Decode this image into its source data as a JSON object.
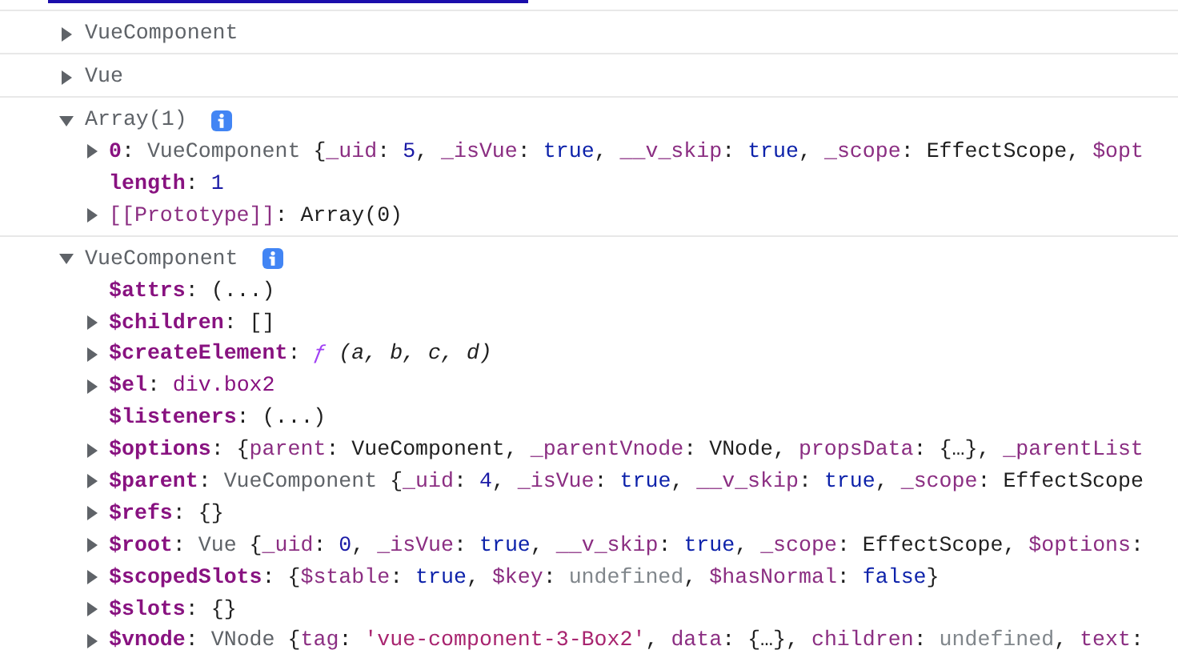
{
  "console_entries": [
    {
      "label": "VueComponent",
      "expanded": false,
      "info_badge": false
    },
    {
      "label": "Vue",
      "expanded": false,
      "info_badge": false
    },
    {
      "label": "Array(1)",
      "expanded": true,
      "info_badge": true,
      "properties": [
        {
          "key": "0",
          "expandable": true,
          "internal": false,
          "value": [
            {
              "kind": "punct",
              "text": ": "
            },
            {
              "kind": "class",
              "text": "VueComponent "
            },
            {
              "kind": "punct",
              "text": "{"
            },
            {
              "kind": "prop",
              "text": "_uid"
            },
            {
              "kind": "punct",
              "text": ": "
            },
            {
              "kind": "num",
              "text": "5"
            },
            {
              "kind": "punct",
              "text": ", "
            },
            {
              "kind": "prop",
              "text": "_isVue"
            },
            {
              "kind": "punct",
              "text": ": "
            },
            {
              "kind": "bool",
              "text": "true"
            },
            {
              "kind": "punct",
              "text": ", "
            },
            {
              "kind": "prop",
              "text": "__v_skip"
            },
            {
              "kind": "punct",
              "text": ": "
            },
            {
              "kind": "bool",
              "text": "true"
            },
            {
              "kind": "punct",
              "text": ", "
            },
            {
              "kind": "prop",
              "text": "_scope"
            },
            {
              "kind": "punct",
              "text": ": EffectScope, "
            },
            {
              "kind": "prop",
              "text": "$opt"
            }
          ]
        },
        {
          "key": "length",
          "expandable": false,
          "internal": false,
          "value": [
            {
              "kind": "punct",
              "text": ": "
            },
            {
              "kind": "num",
              "text": "1"
            }
          ]
        },
        {
          "key": "[[Prototype]]",
          "expandable": true,
          "internal": true,
          "value": [
            {
              "kind": "punct",
              "text": ": Array(0)"
            }
          ]
        }
      ]
    },
    {
      "label": "VueComponent",
      "expanded": true,
      "info_badge": true,
      "properties": [
        {
          "key": "$attrs",
          "expandable": false,
          "internal": false,
          "value": [
            {
              "kind": "punct",
              "text": ": (...)"
            }
          ]
        },
        {
          "key": "$children",
          "expandable": true,
          "internal": false,
          "value": [
            {
              "kind": "punct",
              "text": ": []"
            }
          ]
        },
        {
          "key": "$createElement",
          "expandable": true,
          "internal": false,
          "value": [
            {
              "kind": "punct",
              "text": ": "
            },
            {
              "kind": "func",
              "text": "ƒ"
            },
            {
              "kind": "italic",
              "text": " (a, b, c, d)"
            }
          ]
        },
        {
          "key": "$el",
          "expandable": true,
          "internal": false,
          "value": [
            {
              "kind": "punct",
              "text": ": "
            },
            {
              "kind": "node",
              "text": "div.box2"
            }
          ]
        },
        {
          "key": "$listeners",
          "expandable": false,
          "internal": false,
          "value": [
            {
              "kind": "punct",
              "text": ": (...)"
            }
          ]
        },
        {
          "key": "$options",
          "expandable": true,
          "internal": false,
          "value": [
            {
              "kind": "punct",
              "text": ": {"
            },
            {
              "kind": "prop",
              "text": "parent"
            },
            {
              "kind": "punct",
              "text": ": VueComponent, "
            },
            {
              "kind": "prop",
              "text": "_parentVnode"
            },
            {
              "kind": "punct",
              "text": ": VNode, "
            },
            {
              "kind": "prop",
              "text": "propsData"
            },
            {
              "kind": "punct",
              "text": ": {…}, "
            },
            {
              "kind": "prop",
              "text": "_parentList"
            }
          ]
        },
        {
          "key": "$parent",
          "expandable": true,
          "internal": false,
          "value": [
            {
              "kind": "punct",
              "text": ": "
            },
            {
              "kind": "class",
              "text": "VueComponent "
            },
            {
              "kind": "punct",
              "text": "{"
            },
            {
              "kind": "prop",
              "text": "_uid"
            },
            {
              "kind": "punct",
              "text": ": "
            },
            {
              "kind": "num",
              "text": "4"
            },
            {
              "kind": "punct",
              "text": ", "
            },
            {
              "kind": "prop",
              "text": "_isVue"
            },
            {
              "kind": "punct",
              "text": ": "
            },
            {
              "kind": "bool",
              "text": "true"
            },
            {
              "kind": "punct",
              "text": ", "
            },
            {
              "kind": "prop",
              "text": "__v_skip"
            },
            {
              "kind": "punct",
              "text": ": "
            },
            {
              "kind": "bool",
              "text": "true"
            },
            {
              "kind": "punct",
              "text": ", "
            },
            {
              "kind": "prop",
              "text": "_scope"
            },
            {
              "kind": "punct",
              "text": ": EffectScope"
            }
          ]
        },
        {
          "key": "$refs",
          "expandable": true,
          "internal": false,
          "value": [
            {
              "kind": "punct",
              "text": ": {}"
            }
          ]
        },
        {
          "key": "$root",
          "expandable": true,
          "internal": false,
          "value": [
            {
              "kind": "punct",
              "text": ": "
            },
            {
              "kind": "class",
              "text": "Vue "
            },
            {
              "kind": "punct",
              "text": "{"
            },
            {
              "kind": "prop",
              "text": "_uid"
            },
            {
              "kind": "punct",
              "text": ": "
            },
            {
              "kind": "num",
              "text": "0"
            },
            {
              "kind": "punct",
              "text": ", "
            },
            {
              "kind": "prop",
              "text": "_isVue"
            },
            {
              "kind": "punct",
              "text": ": "
            },
            {
              "kind": "bool",
              "text": "true"
            },
            {
              "kind": "punct",
              "text": ", "
            },
            {
              "kind": "prop",
              "text": "__v_skip"
            },
            {
              "kind": "punct",
              "text": ": "
            },
            {
              "kind": "bool",
              "text": "true"
            },
            {
              "kind": "punct",
              "text": ", "
            },
            {
              "kind": "prop",
              "text": "_scope"
            },
            {
              "kind": "punct",
              "text": ": EffectScope, "
            },
            {
              "kind": "prop",
              "text": "$options"
            },
            {
              "kind": "punct",
              "text": ":"
            }
          ]
        },
        {
          "key": "$scopedSlots",
          "expandable": true,
          "internal": false,
          "value": [
            {
              "kind": "punct",
              "text": ": {"
            },
            {
              "kind": "prop",
              "text": "$stable"
            },
            {
              "kind": "punct",
              "text": ": "
            },
            {
              "kind": "bool",
              "text": "true"
            },
            {
              "kind": "punct",
              "text": ", "
            },
            {
              "kind": "prop",
              "text": "$key"
            },
            {
              "kind": "punct",
              "text": ": "
            },
            {
              "kind": "undef",
              "text": "undefined"
            },
            {
              "kind": "punct",
              "text": ", "
            },
            {
              "kind": "prop",
              "text": "$hasNormal"
            },
            {
              "kind": "punct",
              "text": ": "
            },
            {
              "kind": "bool",
              "text": "false"
            },
            {
              "kind": "punct",
              "text": "}"
            }
          ]
        },
        {
          "key": "$slots",
          "expandable": true,
          "internal": false,
          "value": [
            {
              "kind": "punct",
              "text": ": {}"
            }
          ]
        },
        {
          "key": "$vnode",
          "expandable": true,
          "internal": false,
          "value": [
            {
              "kind": "punct",
              "text": ": "
            },
            {
              "kind": "class",
              "text": "VNode "
            },
            {
              "kind": "punct",
              "text": "{"
            },
            {
              "kind": "prop",
              "text": "tag"
            },
            {
              "kind": "punct",
              "text": ": "
            },
            {
              "kind": "string",
              "text": "'vue-component-3-Box2'"
            },
            {
              "kind": "punct",
              "text": ", "
            },
            {
              "kind": "prop",
              "text": "data"
            },
            {
              "kind": "punct",
              "text": ": {…}, "
            },
            {
              "kind": "prop",
              "text": "children"
            },
            {
              "kind": "punct",
              "text": ": "
            },
            {
              "kind": "undef",
              "text": "undefined"
            },
            {
              "kind": "punct",
              "text": ", "
            },
            {
              "kind": "prop",
              "text": "text"
            },
            {
              "kind": "punct",
              "text": ":"
            }
          ]
        }
      ]
    }
  ]
}
